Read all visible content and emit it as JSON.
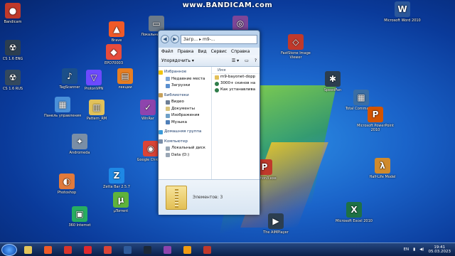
{
  "watermark": "www.BANDICAM.com",
  "desktop_icons": [
    {
      "label": "Bandicam",
      "color": "#c0392b",
      "glyph": "●"
    },
    {
      "label": "CS 1.6 ENG",
      "color": "#2c3e50",
      "glyph": "☢"
    },
    {
      "label": "CS 1.6 RUS",
      "color": "#34495e",
      "glyph": "☢"
    },
    {
      "label": "Панель управления",
      "color": "#4a90d9",
      "glyph": "▦"
    },
    {
      "label": "Andromeda",
      "color": "#7a8ea6",
      "glyph": "✦"
    },
    {
      "label": "Photoshop",
      "color": "#e07a3c",
      "glyph": "◐"
    },
    {
      "label": "360 Internet",
      "color": "#27ae60",
      "glyph": "▣"
    },
    {
      "label": "Brave",
      "color": "#f05a28",
      "glyph": "▲"
    },
    {
      "label": "EPO70003",
      "color": "#e74c3c",
      "glyph": "◆"
    },
    {
      "label": "TagScanner",
      "color": "#1b4f8a",
      "glyph": "♪"
    },
    {
      "label": "ProtonVPN",
      "color": "#6d4aff",
      "glyph": "▽"
    },
    {
      "label": "лекции",
      "color": "#e67e22",
      "glyph": "▤"
    },
    {
      "label": "Pattern_RM",
      "color": "#e1c15a",
      "glyph": "▥"
    },
    {
      "label": "Zetta Bar 2.5.7",
      "color": "#1e88e5",
      "glyph": "Z"
    },
    {
      "label": "µTorrent",
      "color": "#5fb33b",
      "glyph": "µ"
    },
    {
      "label": "Локальный диск",
      "color": "#6c7a89",
      "glyph": "▭"
    },
    {
      "label": "WinRar",
      "color": "#8e44ad",
      "glyph": "✓"
    },
    {
      "label": "Google Chrome",
      "color": "#db4437",
      "glyph": "◉"
    },
    {
      "label": "Браузер Тор",
      "color": "#7d4698",
      "glyph": "◎"
    },
    {
      "label": "FastStone Image Viewer",
      "color": "#c0392b",
      "glyph": "◇"
    },
    {
      "label": "SpeedFan",
      "color": "#2c3e50",
      "glyph": "✱"
    },
    {
      "label": "Total Commander",
      "color": "#3a6ea5",
      "glyph": "▦"
    },
    {
      "label": "Microsoft PowerPoint 2010",
      "color": "#d35400",
      "glyph": "P"
    },
    {
      "label": "Half-Life Model",
      "color": "#d08a2c",
      "glyph": "λ"
    },
    {
      "label": "Microsoft Excel 2010",
      "color": "#1e7145",
      "glyph": "X"
    },
    {
      "label": "Microsoft Word 2010",
      "color": "#2b579a",
      "glyph": "W"
    },
    {
      "label": "psiphon3.exe",
      "color": "#c0392b",
      "glyph": "P"
    },
    {
      "label": "The AIMPlayer",
      "color": "#2c3e50",
      "glyph": "▶"
    }
  ],
  "explorer": {
    "address": "Загр... ▸ m9-...",
    "menu": [
      "Файл",
      "Правка",
      "Вид",
      "Сервис",
      "Справка"
    ],
    "toolbar": {
      "organize": "Упорядочить ▾"
    },
    "nav": {
      "favorites": "Избранное",
      "fav_items": [
        "Недавние места",
        "Загрузки"
      ],
      "libraries": "Библиотеки",
      "lib_items": [
        "Видео",
        "Документы",
        "Изображения",
        "Музыка"
      ],
      "homegroup": "Домашняя группа",
      "computer": "Компьютер",
      "comp_items": [
        "Локальный диск",
        "Data (D:)"
      ]
    },
    "column_header": "Имя",
    "files": [
      "m9-bayonet-dopp",
      "3000+ скинов на",
      "Как устанавлива"
    ],
    "status": "Элементов: 3"
  },
  "taskbar": {
    "lang": "EN",
    "time": "19:41",
    "date": "05.03.2023",
    "pinned": [
      {
        "name": "explorer",
        "color": "#e5c55a"
      },
      {
        "name": "brave",
        "color": "#f05a28"
      },
      {
        "name": "psiphon",
        "color": "#d9342b"
      },
      {
        "name": "opera",
        "color": "#e0282d"
      },
      {
        "name": "chrome",
        "color": "#db4437"
      },
      {
        "name": "teamspeak",
        "color": "#2f5b9b"
      },
      {
        "name": "steam",
        "color": "#1b2838"
      },
      {
        "name": "media",
        "color": "#8e44ad"
      },
      {
        "name": "aimp",
        "color": "#f39c12"
      },
      {
        "name": "bandicam",
        "color": "#c0392b"
      }
    ]
  }
}
